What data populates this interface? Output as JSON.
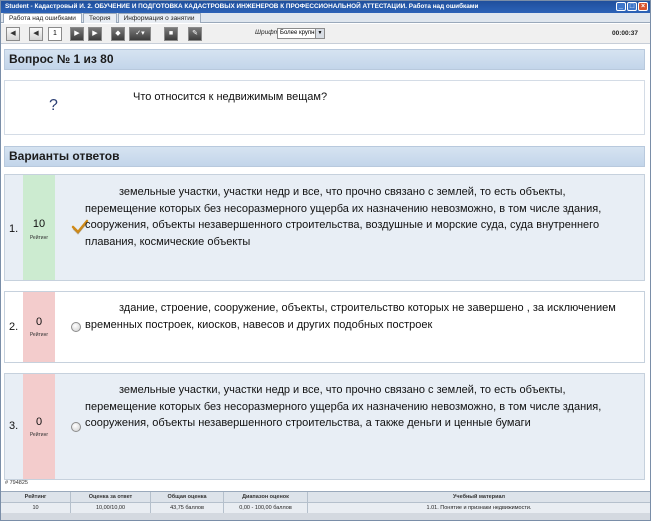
{
  "window": {
    "title": "Student - Кадастровый И. 2. ОБУЧЕНИЕ И ПОДГОТОВКА КАДАСТРОВЫХ ИНЖЕНЕРОВ К ПРОФЕССИОНАЛЬНОЙ АТТЕСТАЦИИ. Работа над ошибками"
  },
  "tabs": [
    {
      "label": "Работа над ошибками",
      "active": true
    },
    {
      "label": "Теория",
      "active": false
    },
    {
      "label": "Информация о занятии",
      "active": false
    }
  ],
  "toolbar": {
    "page_number": "1",
    "font_label": "Шрифт",
    "font_value": "Более крупный",
    "timer": "00:00:37",
    "icons": [
      "prev-icon",
      "next-icon",
      "book-icon",
      "check-dropdown-icon",
      "stop-icon",
      "pen-icon"
    ]
  },
  "question": {
    "header": "Вопрос № 1 из 80",
    "icon": "?",
    "text": "Что относится к недвижимым вещам?"
  },
  "answers_header": "Варианты ответов",
  "answers": [
    {
      "number": "1.",
      "rating": "10",
      "rating_label": "Рейтинг",
      "checked": true,
      "text": "земельные участки, участки недр и все, что прочно связано с землей, то есть объекты, перемещение которых без несоразмерного ущерба их назначению невозможно, в том числе здания, сооружения, объекты незавершенного строительства, воздушные и морские суда, суда внутреннего плавания, космические объекты"
    },
    {
      "number": "2.",
      "rating": "0",
      "rating_label": "Рейтинг",
      "checked": false,
      "text": "здание, строение, сооружение, объекты, строительство которых не завершено , за исключением временных построек, киосков, навесов и других подобных построек"
    },
    {
      "number": "3.",
      "rating": "0",
      "rating_label": "Рейтинг",
      "checked": false,
      "text": "земельные участки, участки недр и все, что прочно связано с землей, то есть объекты, перемещение которых без несоразмерного ущерба их назначению невозможно, в том числе здания, сооружения, объекты незавершенного строительства, а также деньги и ценные бумаги"
    }
  ],
  "footer": {
    "id": "# 794825",
    "columns": [
      {
        "header": "Рейтинг",
        "value": "10"
      },
      {
        "header": "Оценка за ответ",
        "value": "10,00/10,00"
      },
      {
        "header": "Общая оценка",
        "value": "43,75 баллов"
      },
      {
        "header": "Диапазон оценок",
        "value": "0,00 - 100,00 баллов"
      },
      {
        "header": "Учебный материал",
        "value": "1.01. Понятие и признаки недвижимости."
      }
    ]
  },
  "colors": {
    "rating_correct": "#ccebd0",
    "rating_wrong": "#f3cccc",
    "answer_bg_highlight": "#e8eef5",
    "answer_bg": "#ffffff",
    "header_bg": "#c9d9ec",
    "title_bar": "#2558ab"
  }
}
